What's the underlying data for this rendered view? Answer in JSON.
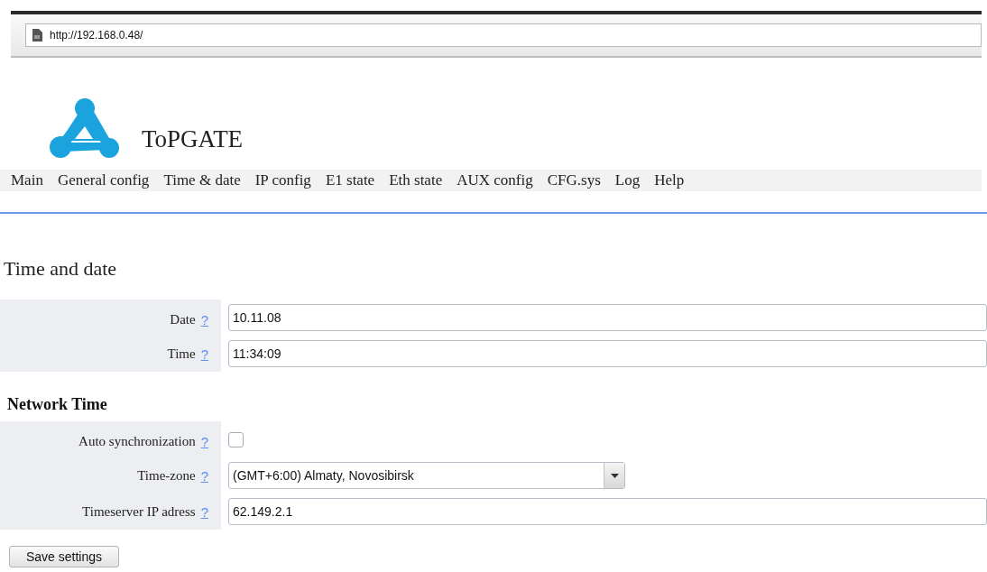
{
  "browser": {
    "url": "http://192.168.0.48/"
  },
  "brand": {
    "name": "ToPGATE"
  },
  "menu": [
    {
      "label": "Main"
    },
    {
      "label": "General config"
    },
    {
      "label": "Time & date"
    },
    {
      "label": "IP config"
    },
    {
      "label": "E1 state"
    },
    {
      "label": "Eth state"
    },
    {
      "label": "AUX config"
    },
    {
      "label": "CFG.sys"
    },
    {
      "label": "Log"
    },
    {
      "label": "Help"
    }
  ],
  "page_title": "Time and date",
  "date_time": {
    "rows": [
      {
        "kind": "text",
        "label": "Date",
        "help": "?",
        "value": "10.11.08"
      },
      {
        "kind": "text",
        "label": "Time",
        "help": "?",
        "value": "11:34:09"
      }
    ]
  },
  "network_time": {
    "title": "Network Time",
    "rows": [
      {
        "kind": "checkbox",
        "label": "Auto synchronization",
        "help": "?",
        "checked": false
      },
      {
        "kind": "select",
        "label": "Time-zone",
        "help": "?",
        "value": "(GMT+6:00) Almaty, Novosibirsk"
      },
      {
        "kind": "text",
        "label": "Timeserver IP adress",
        "help": "?",
        "value": "62.149.2.1"
      }
    ]
  },
  "save_button": "Save settings"
}
